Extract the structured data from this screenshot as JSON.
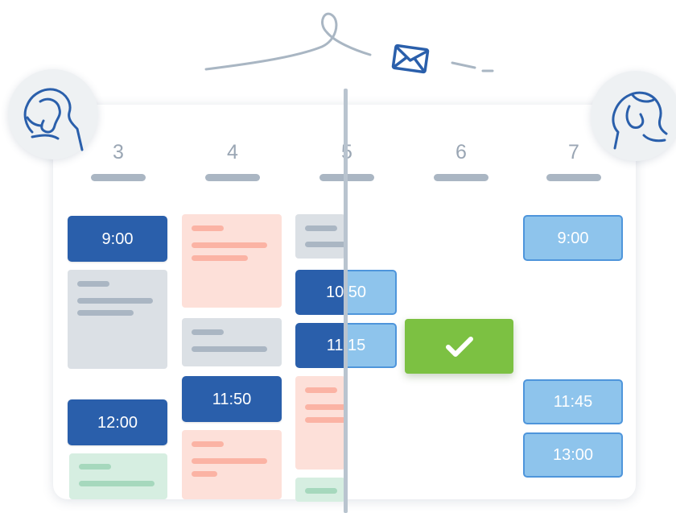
{
  "days": [
    "3",
    "4",
    "5",
    "6",
    "7"
  ],
  "slots": {
    "d3_900": "9:00",
    "d3_1200": "12:00",
    "d4_1150": "11:50",
    "d5_1050": "10:50",
    "d5_1115": "11:15",
    "d7_900": "9:00",
    "d7_1145": "11:45",
    "d7_1300": "13:00"
  },
  "icons": {
    "left_avatar": "woman-portrait-icon",
    "right_avatar": "woman-portrait-icon",
    "message": "envelope-icon",
    "confirm": "checkmark-icon"
  },
  "colors": {
    "booked": "#2a5fab",
    "available": "#8ec4ec",
    "confirm": "#7cc142",
    "busy_pink": "#fde0d9",
    "busy_gray": "#dbe0e5",
    "busy_green": "#d6eee1"
  }
}
